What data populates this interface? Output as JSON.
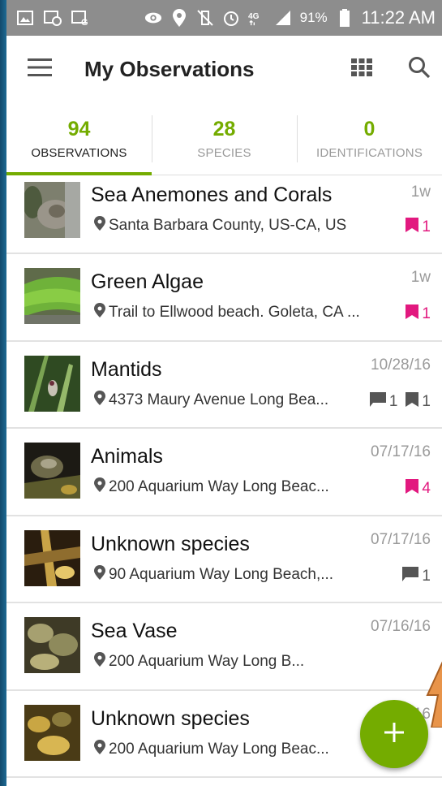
{
  "status_bar": {
    "battery_percent": "91%",
    "time": "11:22 AM",
    "network": "4G"
  },
  "app_bar": {
    "title": "My Observations",
    "icons": [
      "menu-icon",
      "grid-icon",
      "search-icon"
    ]
  },
  "tabs": [
    {
      "count": "94",
      "label": "OBSERVATIONS",
      "active": true
    },
    {
      "count": "28",
      "label": "SPECIES",
      "active": false
    },
    {
      "count": "0",
      "label": "IDENTIFICATIONS",
      "active": false
    }
  ],
  "observations": [
    {
      "name": "Sea Anemones and Corals",
      "date": "1w",
      "place": "Santa Barbara County, US-CA, US",
      "faves": "1",
      "comments": "",
      "ids": ""
    },
    {
      "name": "Green Algae",
      "date": "1w",
      "place": "Trail to Ellwood beach. Goleta, CA ...",
      "faves": "1",
      "comments": "",
      "ids": ""
    },
    {
      "name": "Mantids",
      "date": "10/28/16",
      "place": "4373 Maury Avenue Long Bea...",
      "faves": "",
      "comments": "1",
      "ids": "1"
    },
    {
      "name": "Animals",
      "date": "07/17/16",
      "place": "200 Aquarium Way Long Beac...",
      "faves": "4",
      "comments": "",
      "ids": ""
    },
    {
      "name": "Unknown species",
      "date": "07/17/16",
      "place": "90 Aquarium Way Long Beach,...",
      "faves": "",
      "comments": "1",
      "ids": ""
    },
    {
      "name": "Sea Vase",
      "date": "07/16/16",
      "place": "200 Aquarium Way Long B...",
      "faves": "",
      "comments": "",
      "ids": ""
    },
    {
      "name": "Unknown species",
      "date": "07/16/16",
      "place": "200 Aquarium Way Long Beac...",
      "faves": "",
      "comments": "",
      "ids": ""
    }
  ],
  "fab": {
    "icon": "plus-icon"
  },
  "colors": {
    "accent": "#74ac00",
    "fave": "#e2197f",
    "status_bar": "#8d8d8d"
  }
}
